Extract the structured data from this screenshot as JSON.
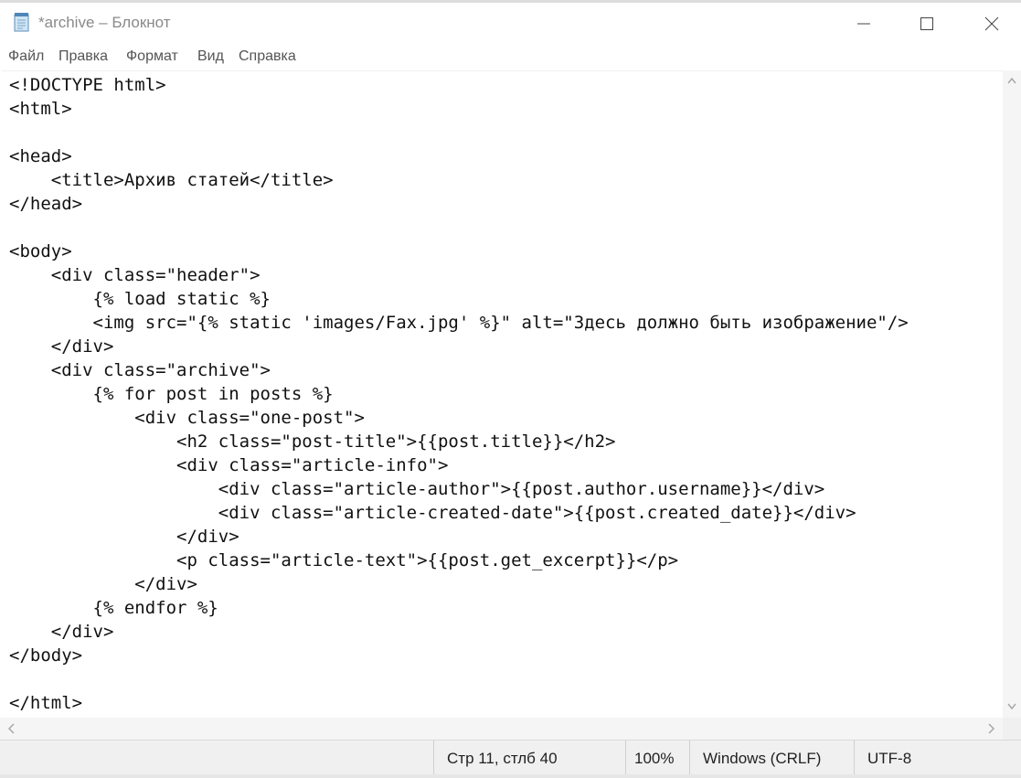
{
  "window": {
    "title": "*archive – Блокнот",
    "icons": {
      "app": "notepad-icon",
      "minimize": "minimize-icon",
      "maximize": "maximize-icon",
      "close": "close-icon"
    }
  },
  "menubar": {
    "items": [
      "Файл",
      "Правка",
      "Формат",
      "Вид",
      "Справка"
    ]
  },
  "editor": {
    "lines": [
      "<!DOCTYPE html>",
      "<html>",
      "",
      "<head>",
      "    <title>Архив статей</title>",
      "</head>",
      "",
      "<body>",
      "    <div class=\"header\">",
      "        {% load static %}",
      "        <img src=\"{% static 'images/Fax.jpg' %}\" alt=\"Здесь должно быть изображение\"/>",
      "    </div>",
      "    <div class=\"archive\">",
      "        {% for post in posts %}",
      "            <div class=\"one-post\">",
      "                <h2 class=\"post-title\">{{post.title}}</h2>",
      "                <div class=\"article-info\">",
      "                    <div class=\"article-author\">{{post.author.username}}</div>",
      "                    <div class=\"article-created-date\">{{post.created_date}}</div>",
      "                </div>",
      "                <p class=\"article-text\">{{post.get_excerpt}}</p>",
      "            </div>",
      "        {% endfor %}",
      "    </div>",
      "</body>",
      "",
      "</html>"
    ]
  },
  "statusbar": {
    "position": "Стр 11, стлб 40",
    "zoom": "100%",
    "line_ending": "Windows (CRLF)",
    "encoding": "UTF-8"
  }
}
